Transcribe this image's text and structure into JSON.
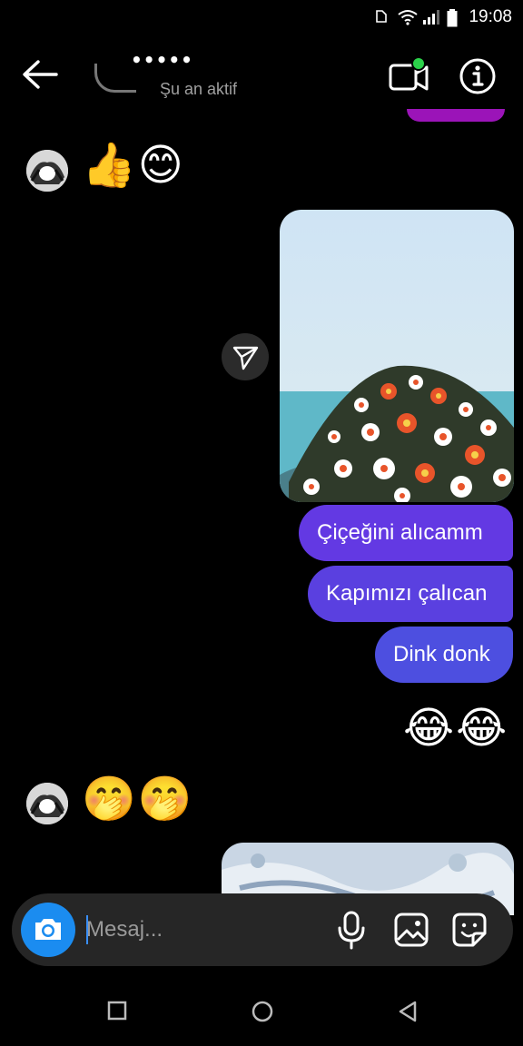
{
  "status_bar": {
    "time": "19:08"
  },
  "header": {
    "contact_name": "•••••",
    "contact_status": "Şu an aktif"
  },
  "messages": {
    "received_emojis_1": "👍😊",
    "sent_texts": [
      "Çiçeğini alıcamm",
      "Kapımızı çalıcan",
      "Dink donk"
    ],
    "sent_emojis": "😂😂",
    "received_emojis_2": "🤭🤭"
  },
  "composer": {
    "placeholder": "Mesaj..."
  },
  "colors": {
    "bubble": "#5a41dc",
    "camera_button": "#1b8cf0",
    "online_dot": "#2bd24a"
  },
  "icons": {
    "back": "arrow-left-icon",
    "video": "video-call-icon",
    "info": "info-icon",
    "share": "paper-plane-icon",
    "camera": "camera-icon",
    "mic": "microphone-icon",
    "gallery": "gallery-icon",
    "sticker": "sticker-icon"
  }
}
